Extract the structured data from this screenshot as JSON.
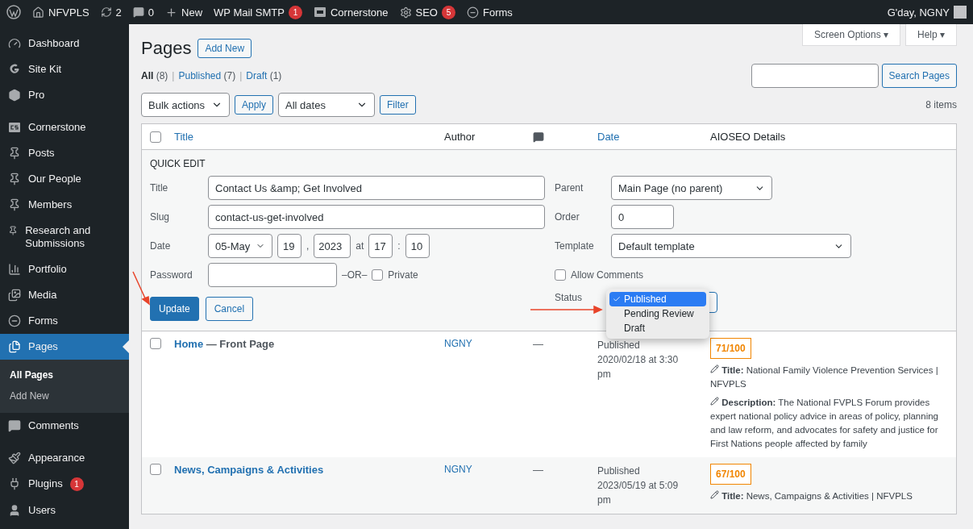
{
  "admin_bar": {
    "site": "NFVPLS",
    "updates": "2",
    "comments": "0",
    "new_label": "New",
    "items": [
      {
        "kind": "none",
        "label": "WP Mail SMTP",
        "badge": "1"
      },
      {
        "kind": "cornerstone",
        "label": "Cornerstone"
      },
      {
        "kind": "gear",
        "label": "SEO",
        "badge": "5"
      },
      {
        "kind": "forms",
        "label": "Forms"
      }
    ],
    "greeting": "G'day, NGNY"
  },
  "sidebar": {
    "groups": [
      [
        {
          "kind": "gauge",
          "label": "Dashboard",
          "selected": false
        },
        {
          "kind": "g",
          "label": "Site Kit",
          "selected": false
        },
        {
          "kind": "hexagon",
          "label": "Pro",
          "selected": false
        }
      ],
      [
        {
          "kind": "cs",
          "label": "Cornerstone",
          "selected": false
        },
        {
          "kind": "pin",
          "label": "Posts",
          "selected": false
        },
        {
          "kind": "pin",
          "label": "Our People",
          "selected": false
        },
        {
          "kind": "pin",
          "label": "Members",
          "selected": false
        },
        {
          "kind": "pin",
          "label": "Research and Submissions",
          "selected": false
        },
        {
          "kind": "chart",
          "label": "Portfolio",
          "selected": false
        },
        {
          "kind": "media",
          "label": "Media",
          "selected": false
        },
        {
          "kind": "forms",
          "label": "Forms",
          "selected": false
        },
        {
          "kind": "pages",
          "label": "Pages",
          "selected": true,
          "children": [
            {
              "label": "All Pages",
              "selected": true
            },
            {
              "label": "Add New",
              "selected": false
            }
          ]
        },
        {
          "kind": "comment",
          "label": "Comments",
          "selected": false
        }
      ],
      [
        {
          "kind": "brush",
          "label": "Appearance",
          "selected": false
        },
        {
          "kind": "plug",
          "label": "Plugins",
          "selected": false,
          "badge": "1"
        },
        {
          "kind": "user",
          "label": "Users",
          "selected": false
        }
      ]
    ]
  },
  "top_buttons": [
    "Screen Options ▾",
    "Help ▾"
  ],
  "heading": "Pages",
  "add_new": "Add New",
  "filter_separator": "|",
  "filters": [
    {
      "label": "All",
      "count": "(8)",
      "selected": true
    },
    {
      "label": "Published",
      "count": "(7)",
      "selected": false
    },
    {
      "label": "Draft",
      "count": "(1)",
      "selected": false
    }
  ],
  "search_button": "Search Pages",
  "bulk_select": "Bulk actions",
  "apply": "Apply",
  "dates_select": "All dates",
  "filter": "Filter",
  "item_count": "8 items",
  "columns": {
    "select_all_checked": false,
    "title": "Title",
    "author": "Author",
    "date": "Date",
    "seo": "AIOSEO Details"
  },
  "quick_edit": {
    "heading": "QUICK EDIT",
    "title_label": "Title",
    "title_value": "Contact Us &amp; Get Involved",
    "slug_label": "Slug",
    "slug_value": "contact-us-get-involved",
    "date_label": "Date",
    "month": "05-May",
    "day": "19",
    "comma": ",",
    "year": "2023",
    "at": "at",
    "hour": "17",
    "colon": ":",
    "minute": "10",
    "password_label": "Password",
    "or": "–OR–",
    "private_label": "Private",
    "private_checked": false,
    "parent_label": "Parent",
    "parent_value": "Main Page (no parent)",
    "order_label": "Order",
    "order_value": "0",
    "template_label": "Template",
    "template_value": "Default template",
    "allow_comments_label": "Allow Comments",
    "allow_comments_checked": false,
    "status_label": "Status",
    "status_options": [
      {
        "label": "Published",
        "selected": true
      },
      {
        "label": "Pending Review",
        "selected": false
      },
      {
        "label": "Draft",
        "selected": false
      }
    ],
    "update": "Update",
    "cancel": "Cancel"
  },
  "rows": [
    {
      "checked": false,
      "title": "Home",
      "suffix": "— Front Page",
      "author": "NGNY",
      "comments": "—",
      "status": "Published",
      "date": "2020/02/18 at 3:30 pm",
      "score": "71/100",
      "seo_title_label": "Title:",
      "seo_title": "National Family Violence Prevention Services | NFVPLS",
      "seo_desc_label": "Description:",
      "seo_desc": "The National FVPLS Forum provides expert national policy advice in areas of policy, planning and law reform, and advocates for safety and justice for First Nations people affected by family"
    },
    {
      "checked": false,
      "title": "News, Campaigns & Activities",
      "author": "NGNY",
      "comments": "—",
      "status": "Published",
      "date": "2023/05/19 at 5:09 pm",
      "score": "67/100",
      "seo_title_label": "Title:",
      "seo_title": "News, Campaigns & Activities | NFVPLS"
    }
  ]
}
